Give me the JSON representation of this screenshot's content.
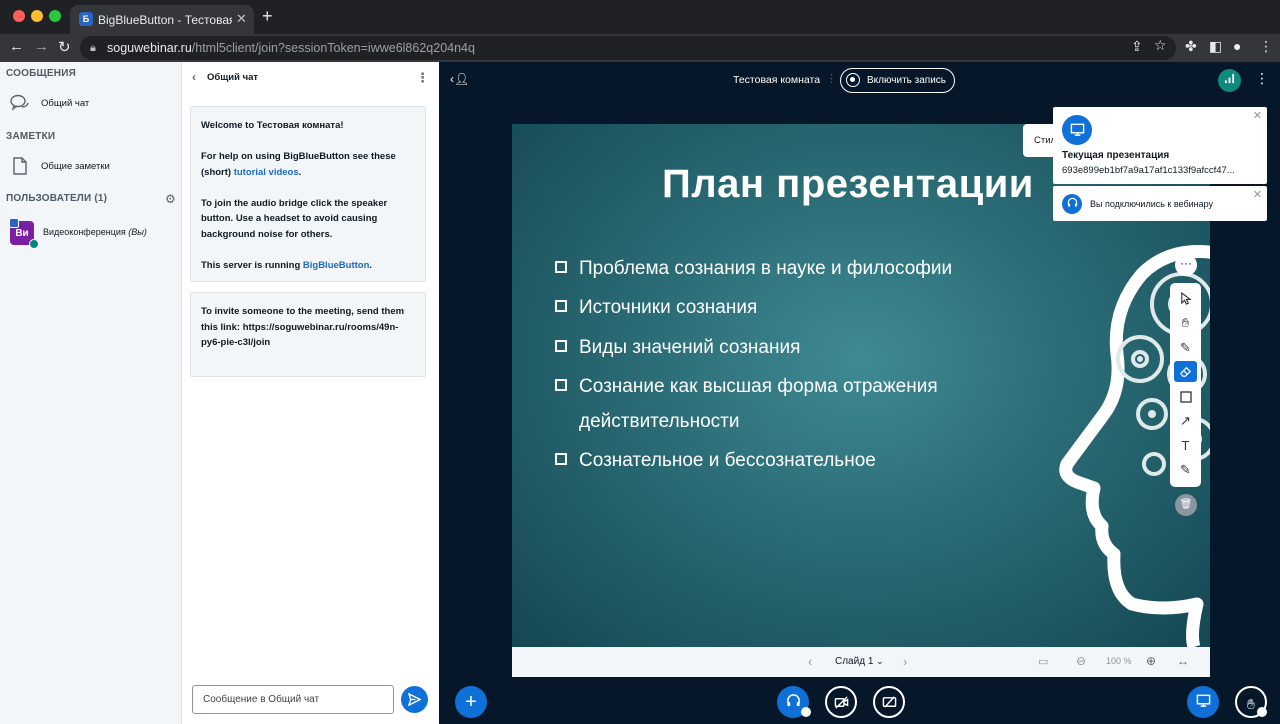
{
  "browser": {
    "tab_title": "BigBlueButton - Тестовая комн",
    "tab_favicon": "Б",
    "url_host": "soguwebinar.ru",
    "url_path": "/html5client/join?sessionToken=iwwe6l862q204n4q"
  },
  "left": {
    "messages_heading": "СООБЩЕНИЯ",
    "public_chat": "Общий чат",
    "notes_heading": "ЗАМЕТКИ",
    "shared_notes": "Общие заметки",
    "users_heading": "ПОЛЬЗОВАТЕЛИ (1)",
    "user_initials": "Ви",
    "user_name": "Видеоконференция",
    "user_you": "(Вы)"
  },
  "chat": {
    "title": "Общий чат",
    "welcome_prefix": "Welcome to",
    "welcome_room": "Тестовая комната!",
    "help_text": "For help on using BigBlueButton see these (short)",
    "help_link": "tutorial videos",
    "help_end": ".",
    "audio_text": "To join the audio bridge click the speaker button. Use a headset to avoid causing background noise for others.",
    "server_text": "This server is running",
    "server_link": "BigBlueButton",
    "server_end": ".",
    "invite_text": "To invite someone to the meeting, send them this link: https://soguwebinar.ru/rooms/49n-py6-pie-c3l/join",
    "input_placeholder": "Сообщение в Общий чат"
  },
  "main": {
    "room_title": "Тестовая комната",
    "record_label": "Включить запись"
  },
  "slide": {
    "title": "План презентации",
    "bullets": [
      "Проблема сознания в науке и философии",
      "Источники сознания",
      "Виды значений сознания",
      "Сознание как высшая форма отражения",
      "действительности",
      "Сознательное и бессознательное"
    ],
    "slide_label": "Слайд 1",
    "zoom": "100 %"
  },
  "toasts": {
    "styles_label": "Стили",
    "presentation_title": "Текущая презентация",
    "presentation_name": "693e899eb1bf7a9a17af1c133f9afccf47...",
    "audio_message": "Вы подключились к вебинару"
  },
  "colors": {
    "primary": "#0f70d7",
    "background_dark": "#06172a",
    "connection_ok": "#0e8a7e"
  }
}
